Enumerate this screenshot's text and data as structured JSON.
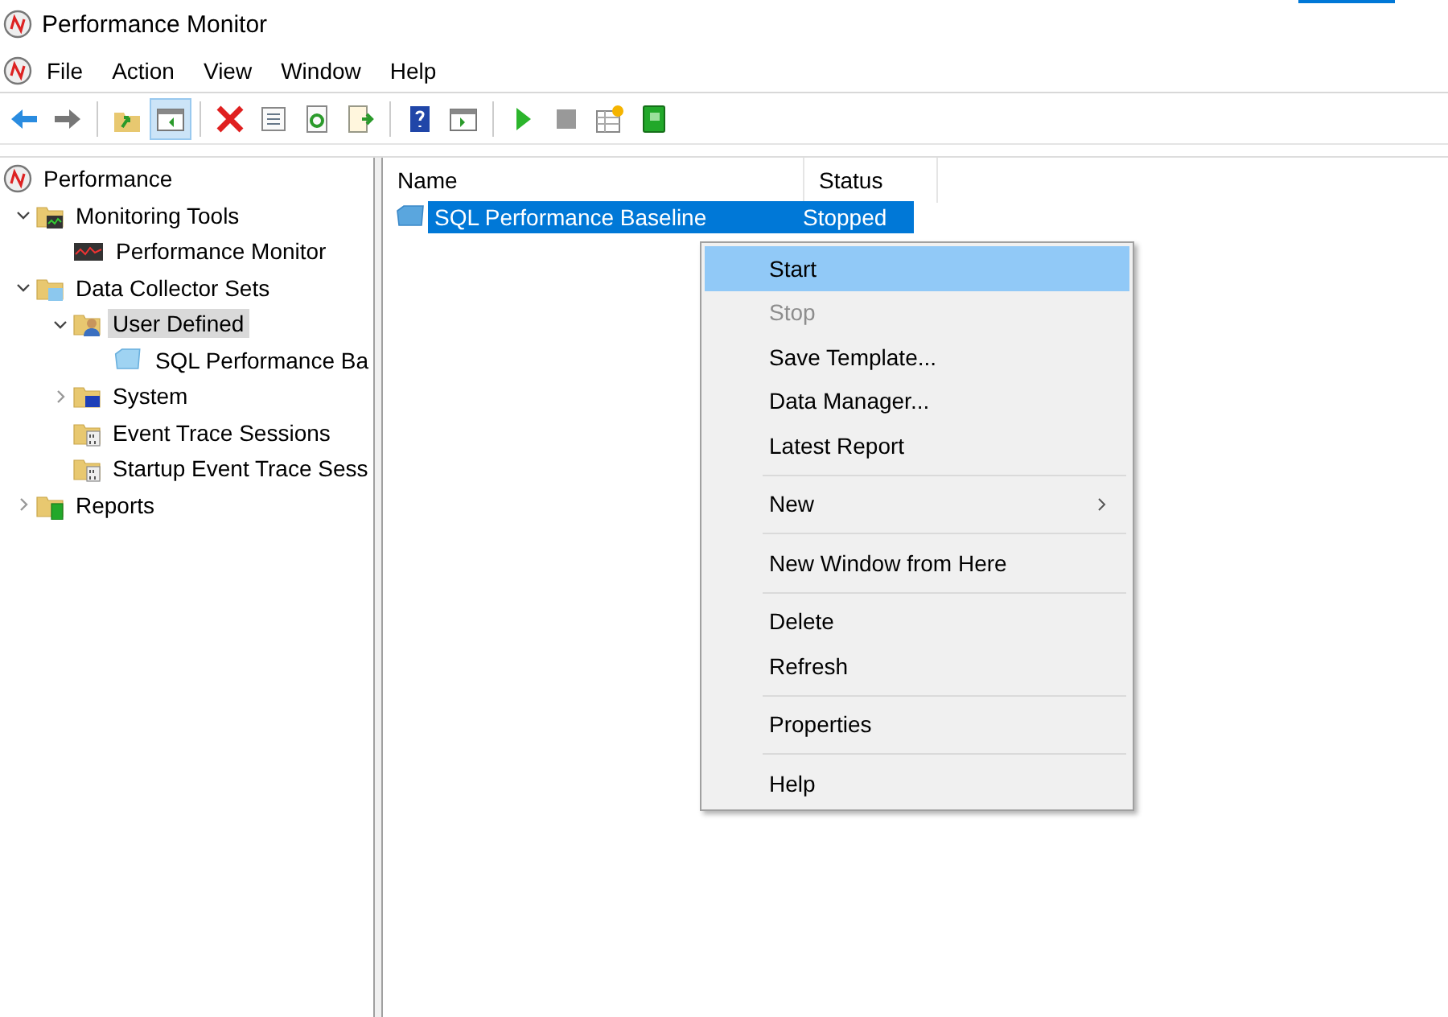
{
  "window": {
    "title": "Performance Monitor"
  },
  "menu_bar": [
    "File",
    "Action",
    "View",
    "Window",
    "Help"
  ],
  "toolbar": [
    {
      "kind": "back",
      "selected": false
    },
    {
      "kind": "forward",
      "selected": false
    },
    {
      "kind": "separator"
    },
    {
      "kind": "up",
      "selected": false
    },
    {
      "kind": "tree",
      "selected": true
    },
    {
      "kind": "separator"
    },
    {
      "kind": "delete",
      "selected": false
    },
    {
      "kind": "properties",
      "selected": false
    },
    {
      "kind": "refresh",
      "selected": false
    },
    {
      "kind": "export",
      "selected": false
    },
    {
      "kind": "separator"
    },
    {
      "kind": "help",
      "selected": false
    },
    {
      "kind": "action-pane",
      "selected": false
    },
    {
      "kind": "separator"
    },
    {
      "kind": "start",
      "selected": false
    },
    {
      "kind": "stop",
      "selected": false
    },
    {
      "kind": "new",
      "selected": false
    },
    {
      "kind": "report",
      "selected": false
    }
  ],
  "tree": [
    {
      "label": "Performance",
      "kind": "gauge",
      "selected": false,
      "children": [
        {
          "label": "Monitoring Tools",
          "kind": "folder-chart",
          "selected": false,
          "expanded": true,
          "children": [
            {
              "label": "Performance Monitor",
              "kind": "chart",
              "selected": false
            }
          ]
        },
        {
          "label": "Data Collector Sets",
          "kind": "folder-cube",
          "selected": false,
          "expanded": true,
          "children": [
            {
              "label": "User Defined",
              "kind": "folder-user",
              "selected": true,
              "expanded": true,
              "children": [
                {
                  "label": "SQL Performance Ba",
                  "kind": "cube",
                  "selected": false
                }
              ]
            },
            {
              "label": "System",
              "kind": "folder-monitor",
              "selected": false,
              "expanded": false
            },
            {
              "label": "Event Trace Sessions",
              "kind": "folder-binary",
              "selected": false
            },
            {
              "label": "Startup Event Trace Sess",
              "kind": "folder-binary",
              "selected": false
            }
          ]
        },
        {
          "label": "Reports",
          "kind": "folder-report",
          "selected": false,
          "expanded": false
        }
      ]
    }
  ],
  "list": {
    "columns": [
      "Name",
      "Status"
    ],
    "rows": [
      {
        "name": "SQL Performance Baseline",
        "status": "Stopped",
        "selected": true
      }
    ]
  },
  "context_menu": [
    {
      "kind": "item",
      "label": "Start",
      "selected": true,
      "disabled": false
    },
    {
      "kind": "item",
      "label": "Stop",
      "selected": false,
      "disabled": true
    },
    {
      "kind": "item",
      "label": "Save Template...",
      "selected": false,
      "disabled": false
    },
    {
      "kind": "item",
      "label": "Data Manager...",
      "selected": false,
      "disabled": false
    },
    {
      "kind": "item",
      "label": "Latest Report",
      "selected": false,
      "disabled": false
    },
    {
      "kind": "separator"
    },
    {
      "kind": "submenu",
      "label": "New",
      "selected": false,
      "disabled": false
    },
    {
      "kind": "separator"
    },
    {
      "kind": "item",
      "label": "New Window from Here",
      "selected": false,
      "disabled": false
    },
    {
      "kind": "separator"
    },
    {
      "kind": "item",
      "label": "Delete",
      "selected": false,
      "disabled": false
    },
    {
      "kind": "item",
      "label": "Refresh",
      "selected": false,
      "disabled": false
    },
    {
      "kind": "separator"
    },
    {
      "kind": "item",
      "label": "Properties",
      "selected": false,
      "disabled": false
    },
    {
      "kind": "separator"
    },
    {
      "kind": "item",
      "label": "Help",
      "selected": false,
      "disabled": false
    }
  ]
}
